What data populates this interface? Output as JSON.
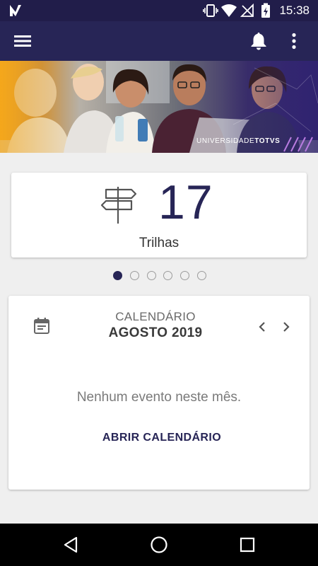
{
  "status_bar": {
    "time": "15:38",
    "icons": [
      "nougat-n-icon",
      "vibrate-icon",
      "wifi-icon",
      "signal-off-icon",
      "battery-charging-icon"
    ]
  },
  "app_bar": {
    "icons": [
      "menu-icon",
      "bell-icon",
      "more-vert-icon"
    ],
    "color": "#272556"
  },
  "banner": {
    "brand_regular": "UNIVERSIDADE",
    "brand_bold": "TOTVS"
  },
  "trails_card": {
    "count": "17",
    "label": "Trilhas",
    "icon": "signpost-icon"
  },
  "pager": {
    "total": 6,
    "active_index": 0
  },
  "calendar_card": {
    "icon": "calendar-icon",
    "title": "CALENDÁRIO",
    "month": "AGOSTO 2019",
    "empty_message": "Nenhum evento neste mês.",
    "open_button": "ABRIR CALENDÁRIO"
  },
  "nav_bar": {
    "icons": [
      "back-icon",
      "home-icon",
      "recents-icon"
    ]
  },
  "colors": {
    "brand_dark": "#272556",
    "background": "#efefef"
  }
}
